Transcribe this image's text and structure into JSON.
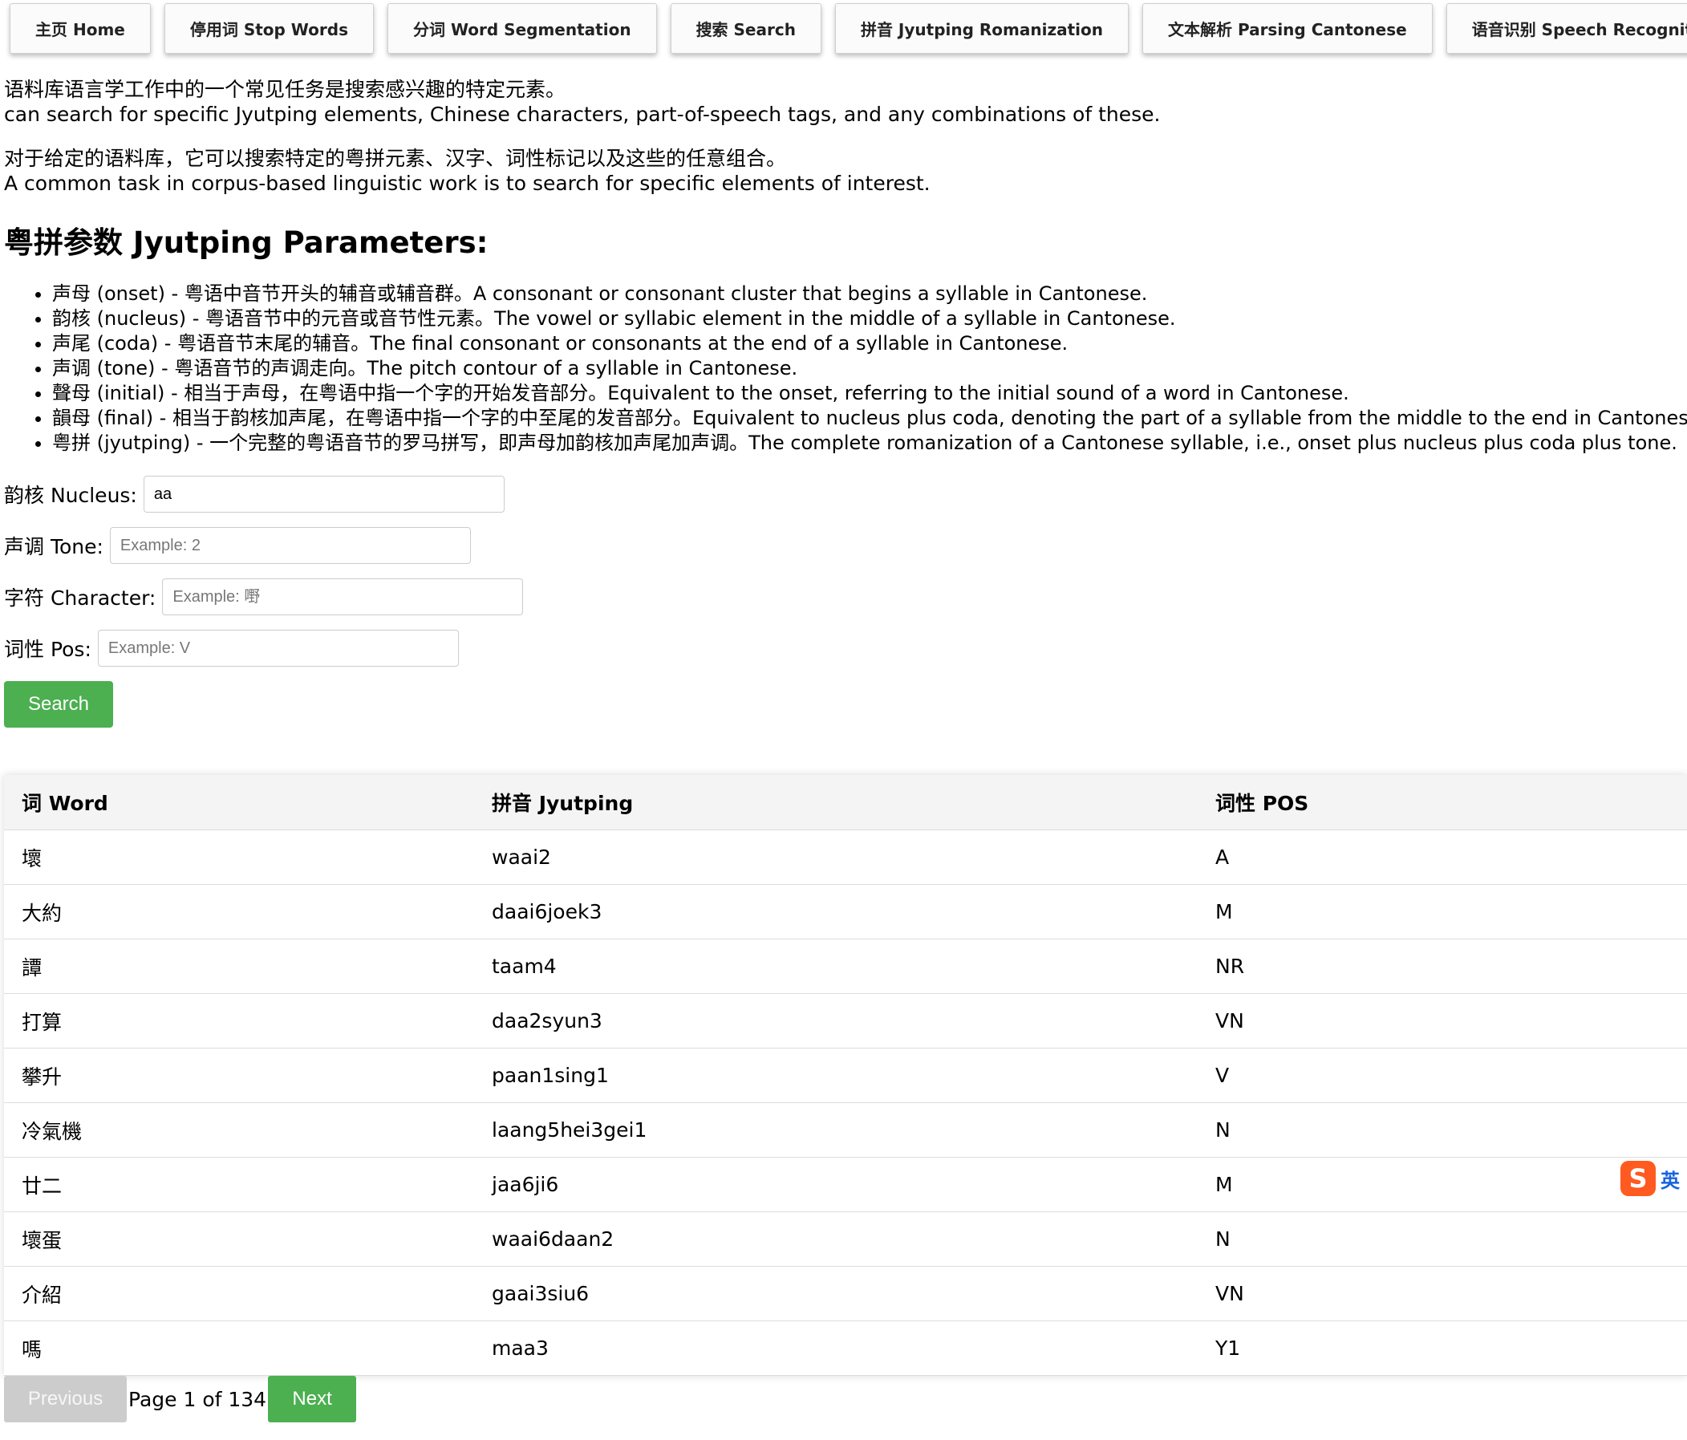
{
  "nav": {
    "items": [
      {
        "label": "主页 Home"
      },
      {
        "label": "停用词 Stop Words"
      },
      {
        "label": "分词 Word Segmentation"
      },
      {
        "label": "搜索 Search"
      },
      {
        "label": "拼音 Jyutping Romanization"
      },
      {
        "label": "文本解析 Parsing Cantonese"
      },
      {
        "label": "语音识别 Speech Recognition"
      }
    ]
  },
  "intro": {
    "p1_line1": "语料库语言学工作中的一个常见任务是搜索感兴趣的特定元素。",
    "p1_line2": "can search for specific Jyutping elements, Chinese characters, part-of-speech tags, and any combinations of these.",
    "p2_line1": "对于给定的语料库，它可以搜索特定的粤拼元素、汉字、词性标记以及这些的任意组合。",
    "p2_line2": "A common task in corpus-based linguistic work is to search for specific elements of interest."
  },
  "params": {
    "heading": "粤拼参数 Jyutping Parameters:",
    "items": [
      "声母 (onset) - 粤语中音节开头的辅音或辅音群。A consonant or consonant cluster that begins a syllable in Cantonese.",
      "韵核 (nucleus) - 粤语音节中的元音或音节性元素。The vowel or syllabic element in the middle of a syllable in Cantonese.",
      "声尾 (coda) - 粤语音节末尾的辅音。The final consonant or consonants at the end of a syllable in Cantonese.",
      "声调 (tone) - 粤语音节的声调走向。The pitch contour of a syllable in Cantonese.",
      "聲母 (initial) - 相当于声母，在粤语中指一个字的开始发音部分。Equivalent to the onset, referring to the initial sound of a word in Cantonese.",
      "韻母 (final) - 相当于韵核加声尾，在粤语中指一个字的中至尾的发音部分。Equivalent to nucleus plus coda, denoting the part of a syllable from the middle to the end in Cantonese.",
      "粤拼 (jyutping) - 一个完整的粤语音节的罗马拼写，即声母加韵核加声尾加声调。The complete romanization of a Cantonese syllable, i.e., onset plus nucleus plus coda plus tone."
    ]
  },
  "form": {
    "nucleus": {
      "label": "韵核 Nucleus:",
      "value": "aa",
      "placeholder": ""
    },
    "tone": {
      "label": "声调 Tone:",
      "value": "",
      "placeholder": "Example: 2"
    },
    "character": {
      "label": "字符 Character:",
      "value": "",
      "placeholder": "Example: 嘢"
    },
    "pos": {
      "label": "词性 Pos:",
      "value": "",
      "placeholder": "Example: V"
    },
    "search_label": "Search"
  },
  "table": {
    "headers": {
      "word": "词 Word",
      "jyutping": "拼音 Jyutping",
      "pos": "词性 POS"
    },
    "rows": [
      {
        "word": "壞",
        "jyutping": "waai2",
        "pos": "A"
      },
      {
        "word": "大約",
        "jyutping": "daai6joek3",
        "pos": "M"
      },
      {
        "word": "譚",
        "jyutping": "taam4",
        "pos": "NR"
      },
      {
        "word": "打算",
        "jyutping": "daa2syun3",
        "pos": "VN"
      },
      {
        "word": "攀升",
        "jyutping": "paan1sing1",
        "pos": "V"
      },
      {
        "word": "冷氣機",
        "jyutping": "laang5hei3gei1",
        "pos": "N"
      },
      {
        "word": "廿二",
        "jyutping": "jaa6ji6",
        "pos": "M"
      },
      {
        "word": "壞蛋",
        "jyutping": "waai6daan2",
        "pos": "N"
      },
      {
        "word": "介紹",
        "jyutping": "gaai3siu6",
        "pos": "VN"
      },
      {
        "word": "嗎",
        "jyutping": "maa3",
        "pos": "Y1"
      }
    ]
  },
  "pager": {
    "prev_label": "Previous",
    "info": "Page 1 of 134",
    "next_label": "Next"
  },
  "ime": {
    "logo": "S",
    "lang": "英"
  },
  "colors": {
    "accent_green": "#4caf50",
    "disabled_gray": "#cccccc",
    "header_bg": "#f4f4f4"
  }
}
